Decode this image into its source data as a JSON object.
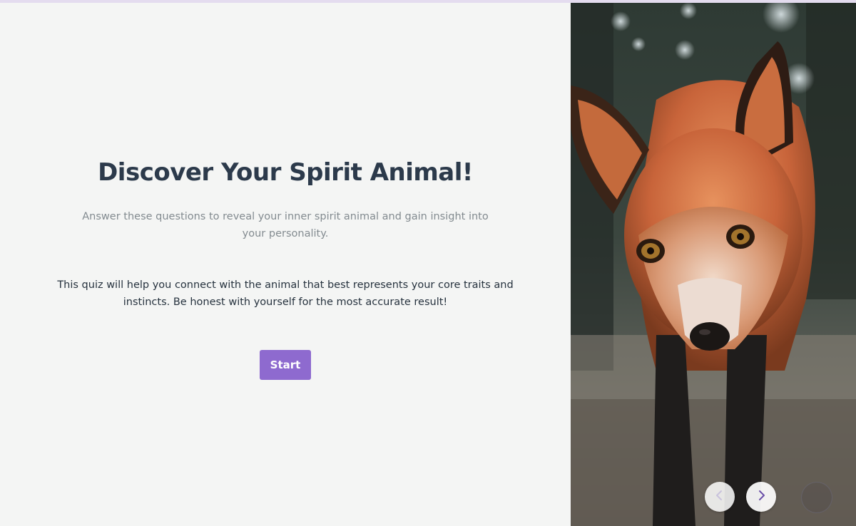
{
  "progress": {
    "fraction": 0.0
  },
  "intro": {
    "title": "Discover Your Spirit Animal!",
    "subtitle": "Answer these questions to reveal your inner spirit animal and gain insight into your personality.",
    "description": "This quiz will help you connect with the animal that best represents your core traits and instincts. Be honest with yourself for the most accurate result!",
    "start_label": "Start"
  },
  "image": {
    "subject": "fox"
  },
  "navigation": {
    "prev_icon": "chevron-left-icon",
    "next_icon": "chevron-right-icon",
    "prev_enabled": false,
    "next_enabled": true
  },
  "colors": {
    "accent": "#8e6acf",
    "title": "#2c3a4b",
    "subtitle": "#838b90",
    "body": "#26323e",
    "background": "#f4f5f4"
  }
}
